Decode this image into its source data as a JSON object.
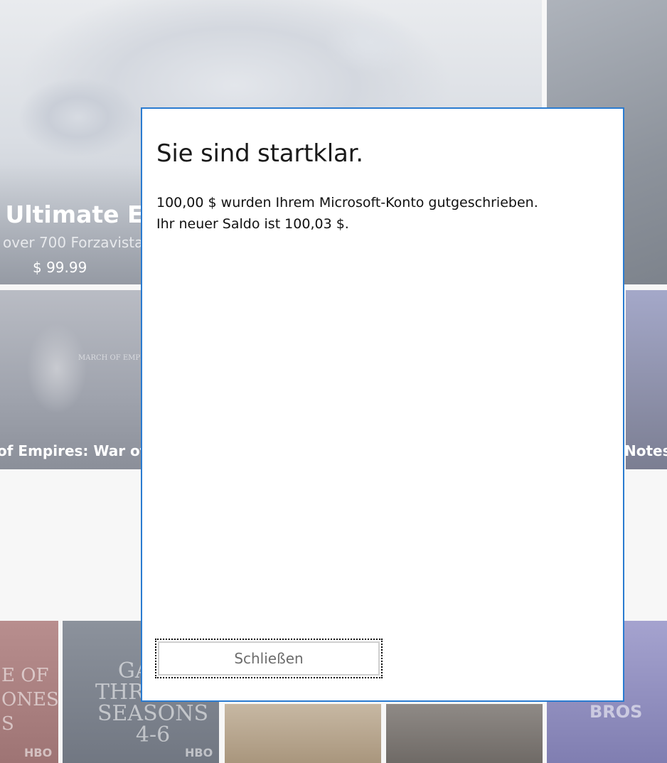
{
  "background": {
    "hero": {
      "title": "/ Ultimate Ed",
      "subtitle": "over 700 Forzavista",
      "price": "$ 99.99"
    },
    "tiles": {
      "left_game_title": "of Empires: War of E",
      "right_game_title": "Notes",
      "knight_banner": "MARCH OF EMPIRES",
      "got1_text": "E OF\nONES\nS",
      "got2_text": "GAME\nTHRONES\nSEASONS\n4-6",
      "bros_text": "BROS",
      "hbo1": "HBO",
      "hbo2": "HBO"
    }
  },
  "dialog": {
    "title": "Sie sind startklar.",
    "message_line1": "100,00 $ wurden Ihrem Microsoft-Konto gutgeschrieben.",
    "message_line2": "Ihr neuer Saldo ist 100,03 $.",
    "close_label": "Schließen"
  },
  "colors": {
    "dialog_border": "#2a7bd0",
    "button_text": "#6d6d6d",
    "focus_outline": "#000000"
  }
}
